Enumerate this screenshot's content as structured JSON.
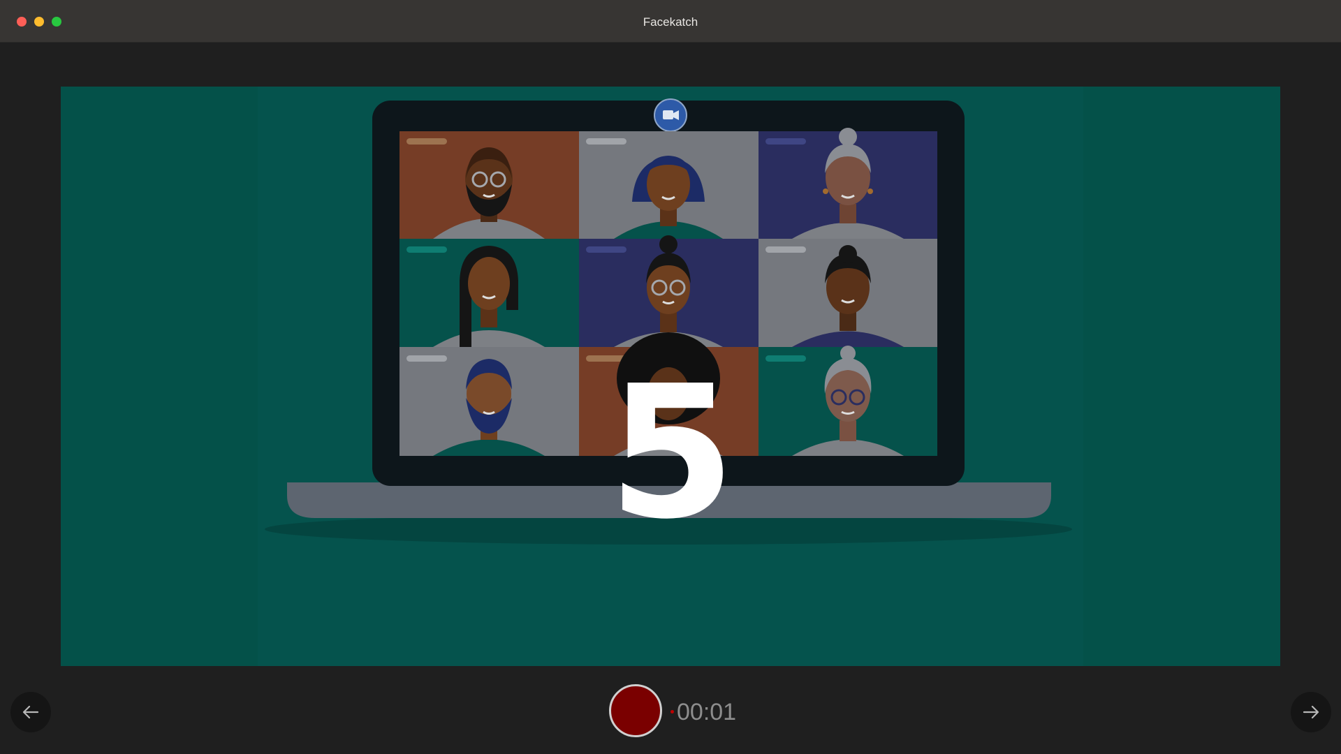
{
  "window": {
    "title": "Facekatch"
  },
  "stage": {
    "countdown": "5",
    "illustration": "video-call-laptop-grid"
  },
  "controls": {
    "prev_icon": "arrow-left-icon",
    "next_icon": "arrow-right-icon",
    "record_icon": "record-icon",
    "timer": "00:01"
  },
  "colors": {
    "stage_background": "#05534d",
    "record_button": "#7a0000",
    "titlebar": "#373533"
  }
}
